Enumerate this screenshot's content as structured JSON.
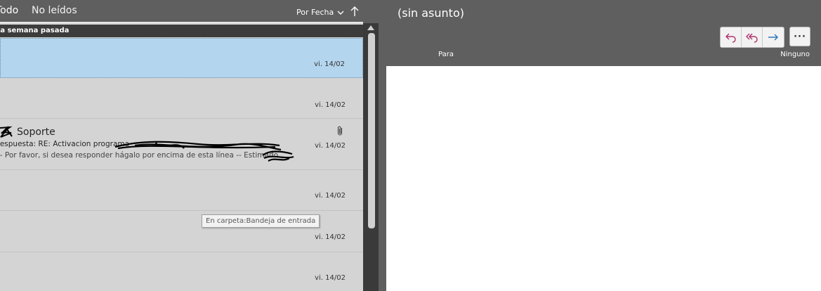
{
  "list": {
    "filters": {
      "all": "Todo",
      "unread": "No leídos"
    },
    "sort": {
      "label": "Por Fecha",
      "chevron_icon": "chevron-down-icon",
      "direction_icon": "arrow-up-icon"
    },
    "group_header": "La semana pasada",
    "rows": [
      {
        "date": "vi. 14/02",
        "selected": true
      },
      {
        "date": "vi. 14/02"
      },
      {
        "sender": "Soporte",
        "subject": "Respuesta: RE: Activacion programa",
        "preview": "-- Por favor, si desea responder hágalo por encima de esta línea --   Estimado",
        "date": "vi. 14/02",
        "has_attachment": true
      },
      {
        "date": "vi. 14/02"
      },
      {
        "date": "vi. 14/02"
      },
      {
        "date": "vi. 14/02"
      }
    ],
    "tooltip": "En carpeta:Bandeja de entrada"
  },
  "reading": {
    "subject": "(sin asunto)",
    "to_label": "Para",
    "category_value": "Ninguno",
    "actions": {
      "reply_icon": "reply-icon",
      "reply_all_icon": "reply-all-icon",
      "forward_icon": "forward-icon",
      "more_label": "···"
    }
  },
  "colors": {
    "selected_row": "#b4d5ee",
    "list_bg": "#d4d4d4",
    "chrome": "#5f5f5f",
    "reply": "#b0306a",
    "forward": "#2e75b6"
  }
}
